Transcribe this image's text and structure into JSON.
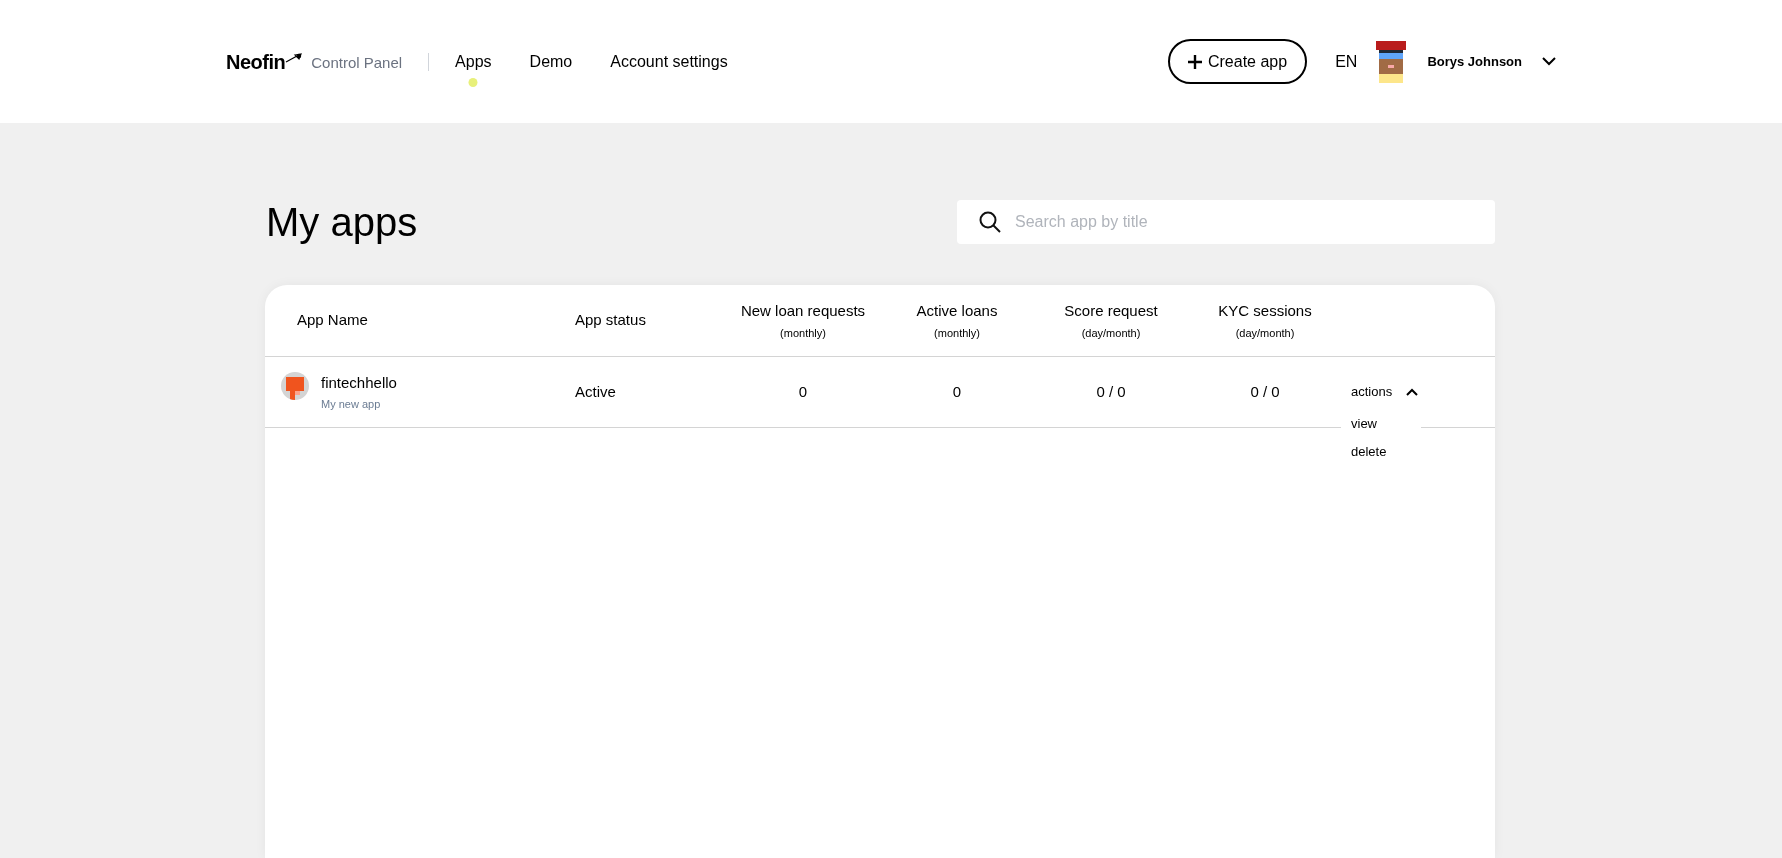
{
  "brand": {
    "name": "Neofin",
    "subtitle": "Control Panel"
  },
  "nav": [
    {
      "label": "Apps",
      "selected": true
    },
    {
      "label": "Demo",
      "selected": false
    },
    {
      "label": "Account settings",
      "selected": false
    }
  ],
  "create_button": "Create app",
  "language": "EN",
  "user": {
    "name": "Borys Johnson"
  },
  "page_title": "My apps",
  "search": {
    "placeholder": "Search app by title"
  },
  "table": {
    "columns": [
      {
        "title": "App Name"
      },
      {
        "title": "App status"
      },
      {
        "title": "New loan requests",
        "sub": "(monthly)"
      },
      {
        "title": "Active loans",
        "sub": "(monthly)"
      },
      {
        "title": "Score request",
        "sub": "(day/month)"
      },
      {
        "title": "KYC sessions",
        "sub": "(day/month)"
      }
    ],
    "rows": [
      {
        "name": "fintechhello",
        "subtitle": "My new app",
        "status": "Active",
        "new_loans": "0",
        "active_loans": "0",
        "score": "0 / 0",
        "kyc": "0 / 0",
        "actions": {
          "label": "actions",
          "expanded": true,
          "items": [
            "view",
            "delete"
          ]
        }
      }
    ]
  }
}
